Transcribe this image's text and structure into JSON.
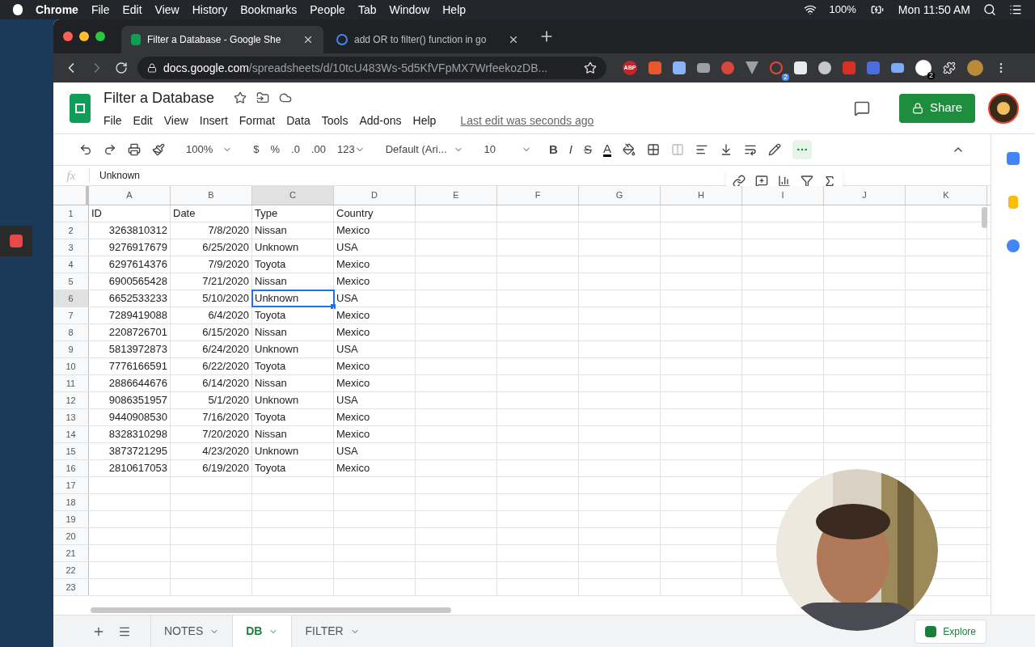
{
  "menu_bar": {
    "app": "Chrome",
    "items": [
      "File",
      "Edit",
      "View",
      "History",
      "Bookmarks",
      "People",
      "Tab",
      "Window",
      "Help"
    ],
    "battery": "100%",
    "clock": "Mon 11:50 AM"
  },
  "browser": {
    "tabs": [
      {
        "title": "Filter a Database - Google She",
        "selected": true
      },
      {
        "title": "add OR to filter() function in go",
        "selected": false
      }
    ],
    "url_host": "docs.google.com",
    "url_path": "/spreadsheets/d/10tcU483Ws-5d5KfVFpMX7WrfeekozDB...",
    "abp_label": "ABP",
    "extension_badges": [
      "2",
      "2"
    ]
  },
  "document": {
    "title": "Filter a Database",
    "menus": [
      "File",
      "Edit",
      "View",
      "Insert",
      "Format",
      "Data",
      "Tools",
      "Add-ons",
      "Help"
    ],
    "last_edit": "Last edit was seconds ago",
    "share": "Share"
  },
  "toolbar": {
    "zoom": "100%",
    "currency": "$",
    "percent": "%",
    "decrease_decimals": ".0",
    "increase_decimals": ".00",
    "number_format": "123",
    "font": "Default (Ari...",
    "font_size": "10",
    "bold": "B",
    "italic": "I",
    "strikethrough": "S",
    "text_color": "A"
  },
  "formula_bar": {
    "fx": "fx",
    "value": "Unknown"
  },
  "sheet": {
    "columns": [
      {
        "label": "A",
        "kind": "number",
        "selected": false
      },
      {
        "label": "B",
        "kind": "number",
        "selected": false
      },
      {
        "label": "C",
        "kind": "text",
        "selected": true
      },
      {
        "label": "D",
        "kind": "text",
        "selected": false
      },
      {
        "label": "E",
        "kind": "text",
        "selected": false
      },
      {
        "label": "F",
        "kind": "text",
        "selected": false
      },
      {
        "label": "G",
        "kind": "text",
        "selected": false
      },
      {
        "label": "H",
        "kind": "text",
        "selected": false
      },
      {
        "label": "I",
        "kind": "text",
        "selected": false
      },
      {
        "label": "J",
        "kind": "text",
        "selected": false
      },
      {
        "label": "K",
        "kind": "text",
        "selected": false
      }
    ],
    "rows": [
      {
        "number": "1",
        "kind": "header",
        "selected": false,
        "cells": [
          "ID",
          "Date",
          "Type",
          "Country"
        ]
      },
      {
        "number": "2",
        "kind": "data",
        "selected": false,
        "cells": [
          "3263810312",
          "7/8/2020",
          "Nissan",
          "Mexico"
        ]
      },
      {
        "number": "3",
        "kind": "data",
        "selected": false,
        "cells": [
          "9276917679",
          "6/25/2020",
          "Unknown",
          "USA"
        ]
      },
      {
        "number": "4",
        "kind": "data",
        "selected": false,
        "cells": [
          "6297614376",
          "7/9/2020",
          "Toyota",
          "Mexico"
        ]
      },
      {
        "number": "5",
        "kind": "data",
        "selected": false,
        "cells": [
          "6900565428",
          "7/21/2020",
          "Nissan",
          "Mexico"
        ]
      },
      {
        "number": "6",
        "kind": "data",
        "selected": true,
        "cells": [
          "6652533233",
          "5/10/2020",
          "Unknown",
          "USA"
        ]
      },
      {
        "number": "7",
        "kind": "data",
        "selected": false,
        "cells": [
          "7289419088",
          "6/4/2020",
          "Toyota",
          "Mexico"
        ]
      },
      {
        "number": "8",
        "kind": "data",
        "selected": false,
        "cells": [
          "2208726701",
          "6/15/2020",
          "Nissan",
          "Mexico"
        ]
      },
      {
        "number": "9",
        "kind": "data",
        "selected": false,
        "cells": [
          "5813972873",
          "6/24/2020",
          "Unknown",
          "USA"
        ]
      },
      {
        "number": "10",
        "kind": "data",
        "selected": false,
        "cells": [
          "7776166591",
          "6/22/2020",
          "Toyota",
          "Mexico"
        ]
      },
      {
        "number": "11",
        "kind": "data",
        "selected": false,
        "cells": [
          "2886644676",
          "6/14/2020",
          "Nissan",
          "Mexico"
        ]
      },
      {
        "number": "12",
        "kind": "data",
        "selected": false,
        "cells": [
          "9086351957",
          "5/1/2020",
          "Unknown",
          "USA"
        ]
      },
      {
        "number": "13",
        "kind": "data",
        "selected": false,
        "cells": [
          "9440908530",
          "7/16/2020",
          "Toyota",
          "Mexico"
        ]
      },
      {
        "number": "14",
        "kind": "data",
        "selected": false,
        "cells": [
          "8328310298",
          "7/20/2020",
          "Nissan",
          "Mexico"
        ]
      },
      {
        "number": "15",
        "kind": "data",
        "selected": false,
        "cells": [
          "3873721295",
          "4/23/2020",
          "Unknown",
          "USA"
        ]
      },
      {
        "number": "16",
        "kind": "data",
        "selected": false,
        "cells": [
          "2810617053",
          "6/19/2020",
          "Toyota",
          "Mexico"
        ]
      },
      {
        "number": "17",
        "kind": "data",
        "selected": false
      },
      {
        "number": "18",
        "kind": "data",
        "selected": false
      },
      {
        "number": "19",
        "kind": "data",
        "selected": false
      },
      {
        "number": "20",
        "kind": "data",
        "selected": false
      },
      {
        "number": "21",
        "kind": "data",
        "selected": false
      },
      {
        "number": "22",
        "kind": "data",
        "selected": false
      },
      {
        "number": "23",
        "kind": "data",
        "selected": false
      }
    ]
  },
  "sheet_tabs": [
    {
      "label": "NOTES",
      "selected": false
    },
    {
      "label": "DB",
      "selected": true
    },
    {
      "label": "FILTER",
      "selected": false
    }
  ],
  "explore": "Explore"
}
